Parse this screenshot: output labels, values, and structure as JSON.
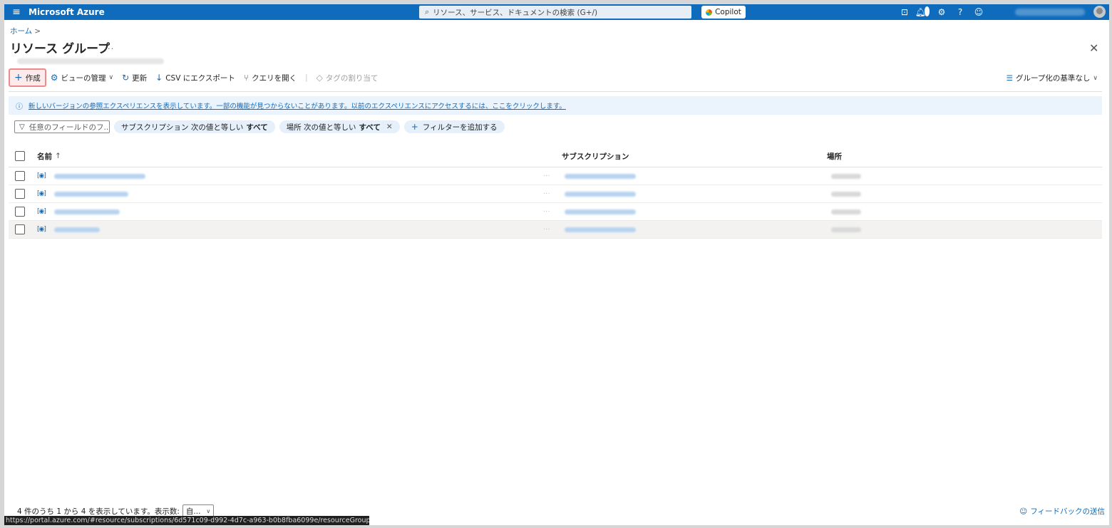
{
  "topbar": {
    "brand": "Microsoft Azure",
    "search_placeholder": "リソース、サービス、ドキュメントの検索 (G+/)",
    "copilot_label": "Copilot",
    "notification_count": "1"
  },
  "header": {
    "breadcrumb_home": "ホーム",
    "breadcrumb_sep": ">",
    "title": "リソース グループ",
    "more": "..."
  },
  "toolbar": {
    "create": "作成",
    "manage_view": "ビューの管理",
    "refresh": "更新",
    "export_csv": "CSV にエクスポート",
    "open_query": "クエリを開く",
    "assign_tags": "タグの割り当て",
    "group_by": "グループ化の基準なし"
  },
  "banner": {
    "text": "新しいバージョンの参照エクスペリエンスを表示しています。一部の機能が見つからないことがあります。以前のエクスペリエンスにアクセスするには、ここをクリックします。"
  },
  "filters": {
    "field_placeholder": "任意のフィールドのフ...",
    "subscription_pill": "サブスクリプション 次の値と等しい",
    "subscription_value": "すべて",
    "location_pill": "場所 次の値と等しい",
    "location_value": "すべて",
    "add_filter": "フィルターを追加する"
  },
  "table": {
    "columns": {
      "name": "名前",
      "sort": "↑",
      "subscription": "サブスクリプション",
      "location": "場所"
    },
    "rows": [
      {
        "hover": false
      },
      {
        "hover": false
      },
      {
        "hover": false
      },
      {
        "hover": true
      }
    ]
  },
  "footer": {
    "summary": "4 件のうち 1 から 4 を表示しています。表示数:",
    "page_size": "自...",
    "feedback": "フィードバックの送信",
    "status_url": "https://portal.azure.com/#resource/subscriptions/6d571c09-d992-4d7c-a963-b0b8fba6099e/resourceGroups/nakam..."
  }
}
